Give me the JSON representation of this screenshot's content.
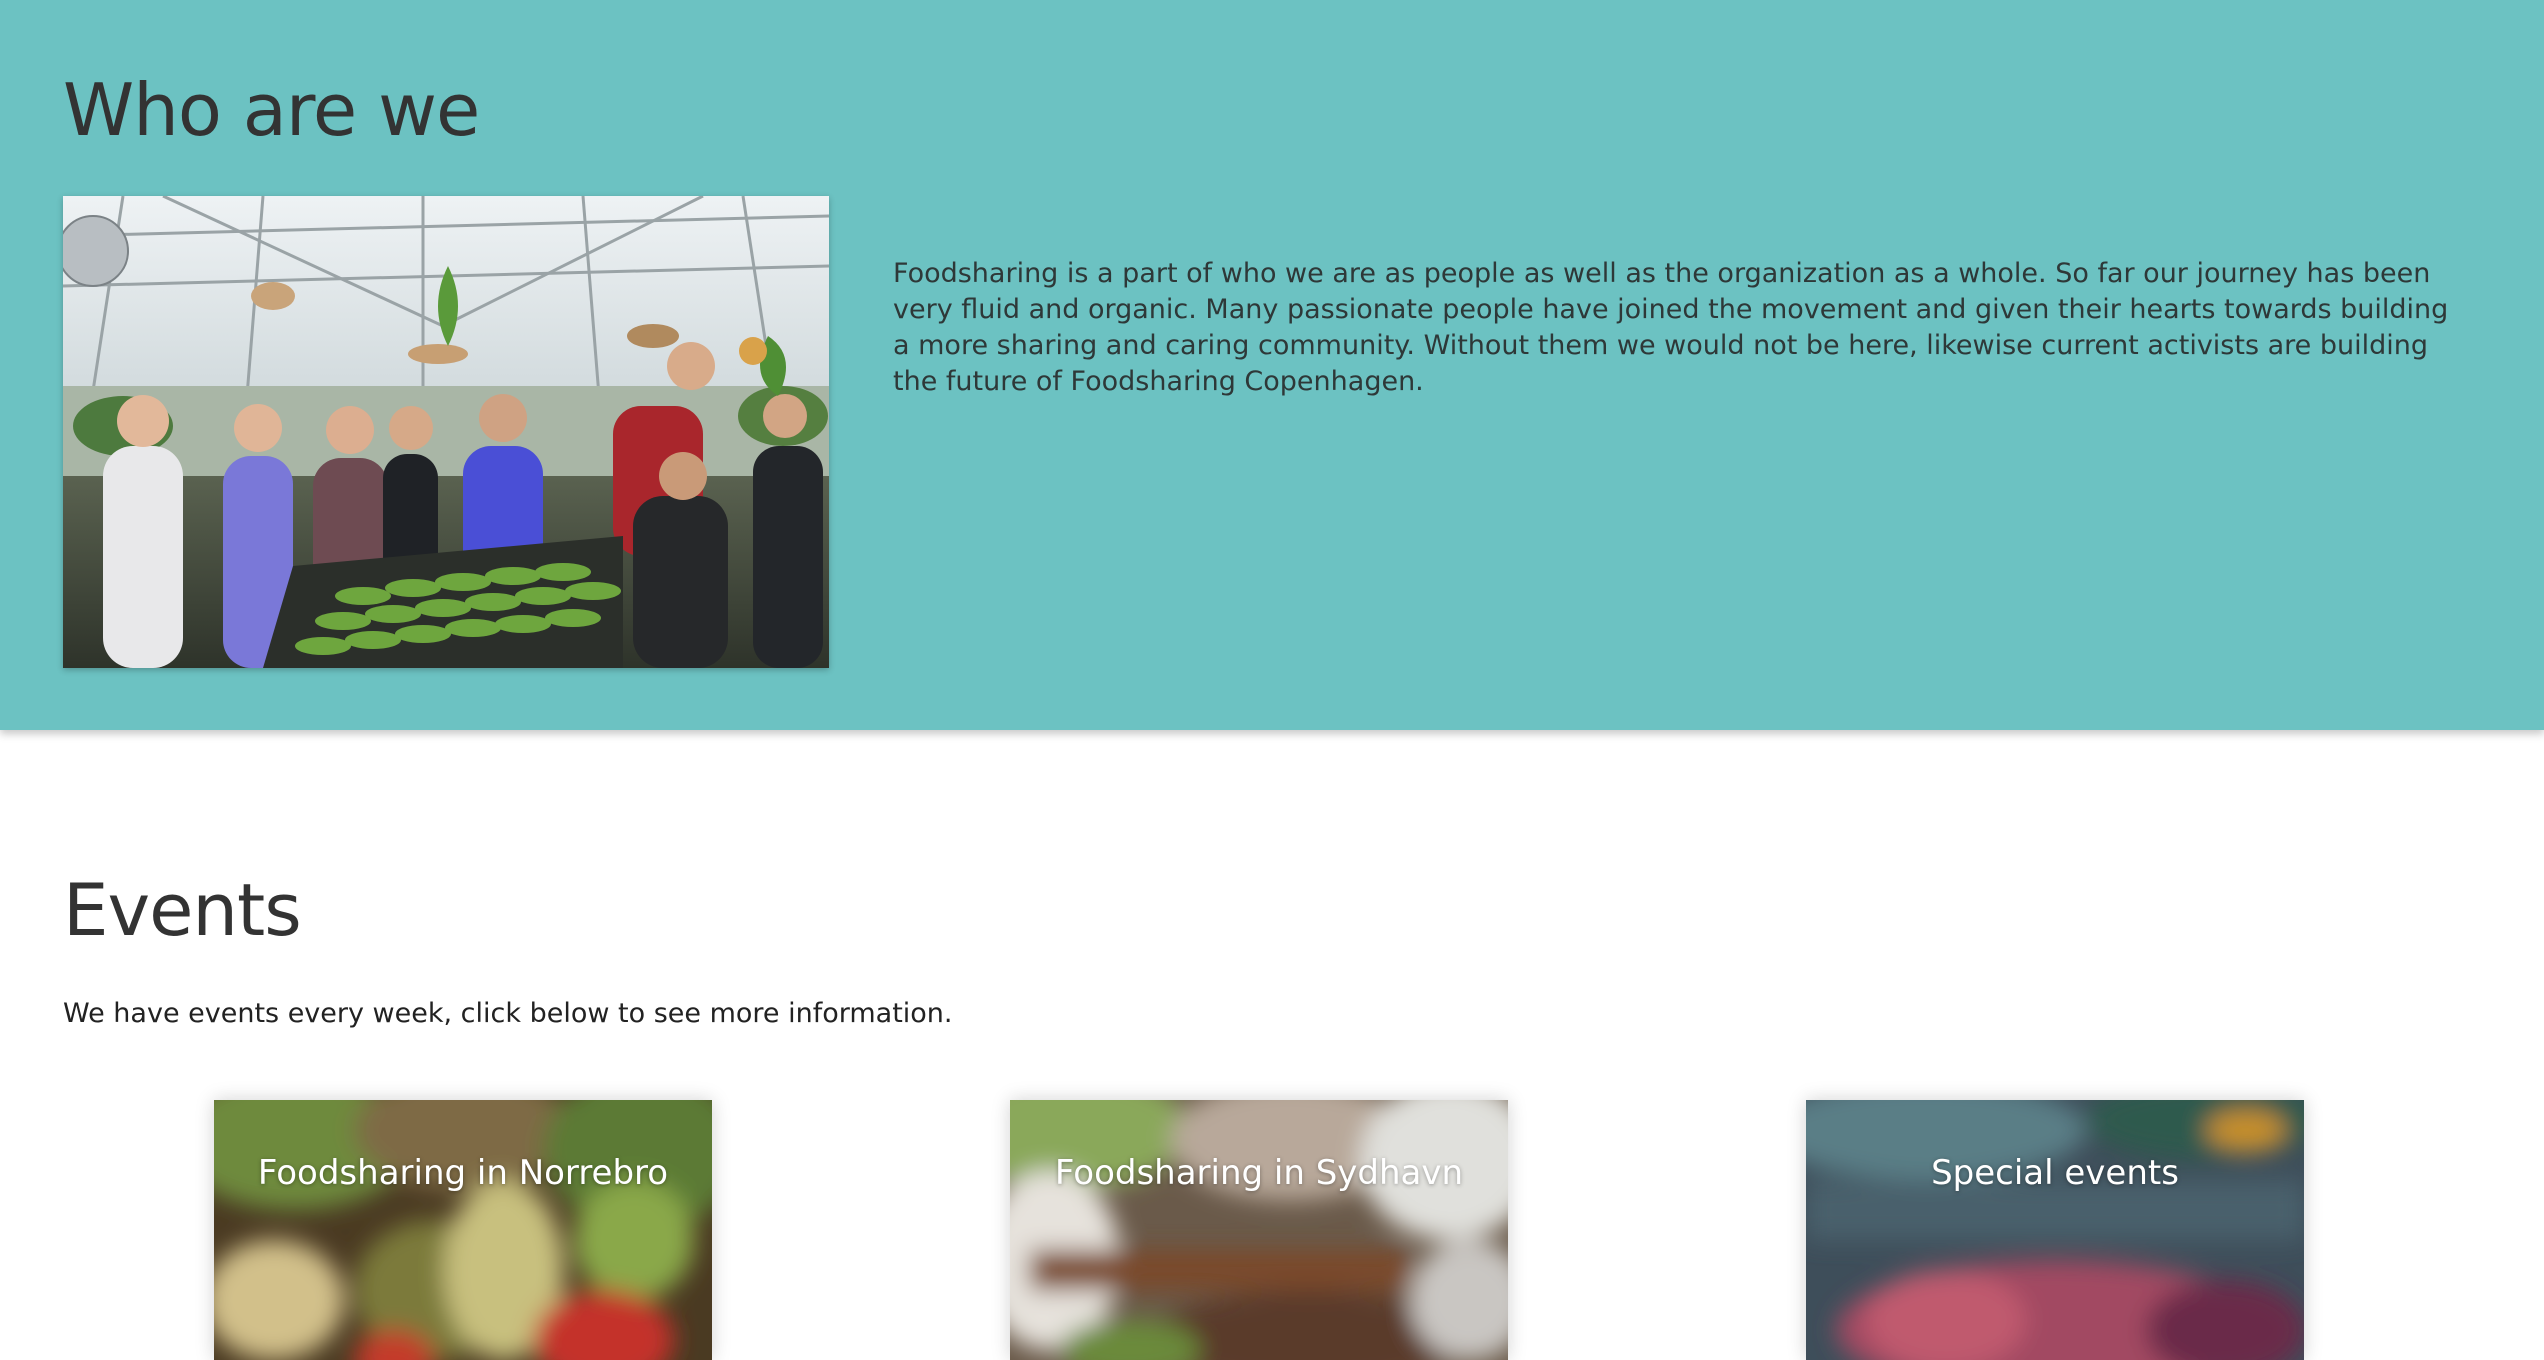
{
  "who": {
    "title": "Who are we",
    "paragraph": "Foodsharing is a part of who we are as people as well as the organization as a whole. So far our journey has been very fluid and organic. Many passionate people have joined the movement and given their hearts towards building a more sharing and caring community. Without them we would not be here, likewise current activists are building the future of Foodsharing Copenhagen.",
    "background_color": "#6cc2c2"
  },
  "events": {
    "title": "Events",
    "intro": "We have events every week, click below to see more information.",
    "cards": [
      {
        "label": "Foodsharing in Norrebro"
      },
      {
        "label": "Foodsharing in Sydhavn"
      },
      {
        "label": "Special events"
      }
    ]
  }
}
